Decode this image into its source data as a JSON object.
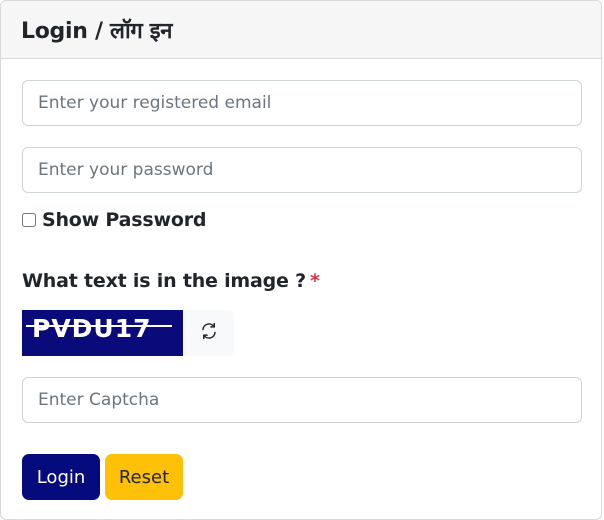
{
  "header": {
    "title": "Login / लॉग इन"
  },
  "form": {
    "email_placeholder": "Enter your registered email",
    "password_placeholder": "Enter your password",
    "show_password_label": "Show Password",
    "captcha_label": "What text is in the image ?",
    "captcha_required_mark": "*",
    "captcha_text": "PVDU17",
    "captcha_placeholder": "Enter Captcha",
    "login_label": "Login",
    "reset_label": "Reset"
  },
  "icons": {
    "refresh": "refresh-icon"
  },
  "colors": {
    "login_button": "#050a7c",
    "reset_button": "#ffc107",
    "required_mark": "#dc3545",
    "captcha_background": "#0a0a7a"
  }
}
